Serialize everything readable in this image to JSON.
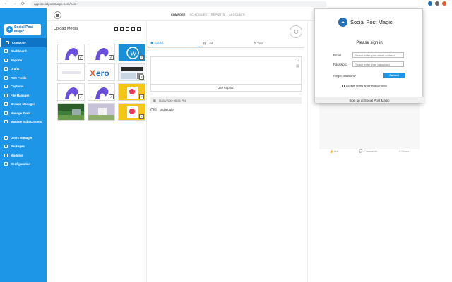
{
  "browser": {
    "url": "app.socialpostmagic.com/post",
    "nav_back": "←",
    "nav_forward": "→",
    "nav_reload": "⟳"
  },
  "brand": {
    "name": "Social Post Magic",
    "logo_text": "Social Post Magic"
  },
  "sidebar": {
    "items": [
      {
        "label": "Compose",
        "icon": "pencil-icon",
        "active": true
      },
      {
        "label": "Dashboard",
        "icon": "dashboard-icon"
      },
      {
        "label": "Reports",
        "icon": "chart-icon"
      },
      {
        "label": "Drafts",
        "icon": "draft-icon"
      },
      {
        "label": "RSS Feeds",
        "icon": "rss-icon"
      },
      {
        "label": "Captions",
        "icon": "caption-icon"
      },
      {
        "label": "File Manager",
        "icon": "folder-icon"
      },
      {
        "label": "Groups Manager",
        "icon": "group-icon"
      },
      {
        "label": "Manage Team",
        "icon": "team-icon"
      },
      {
        "label": "Manage Subaccounts",
        "icon": "subaccount-icon"
      }
    ],
    "items2": [
      {
        "label": "Users Manager",
        "icon": "users-icon"
      },
      {
        "label": "Packages",
        "icon": "package-icon"
      },
      {
        "label": "Modules",
        "icon": "module-icon"
      },
      {
        "label": "Configuration",
        "icon": "gear-icon"
      }
    ]
  },
  "tabs": {
    "compose": "COMPOSE",
    "schedules": "SCHEDULES",
    "reports": "REPORTS",
    "accounts": "ACCOUNTS"
  },
  "upload": {
    "title": "Upload Media"
  },
  "composer": {
    "tab_media": "Media",
    "tab_link": "Link",
    "tab_text": "Text",
    "use_caption": "Use caption",
    "datetime": "11/26/2020 05:26 PM",
    "schedule_label": "Schedule"
  },
  "preview": {
    "like": "like",
    "comments": "Comments",
    "share": "Share"
  },
  "popup": {
    "title": "Please sign in",
    "email_label": "Email",
    "email_placeholder": "Please enter your email address",
    "password_label": "Password",
    "password_placeholder": "Please enter your password",
    "forgot": "Forgot password?",
    "submit": "Submit",
    "accept": "Accept Terms and Privacy Policy",
    "signup": "Sign up at Social Post Magic"
  },
  "colors": {
    "accent": "#1e96e8",
    "sidebar": "#1e96e8"
  }
}
